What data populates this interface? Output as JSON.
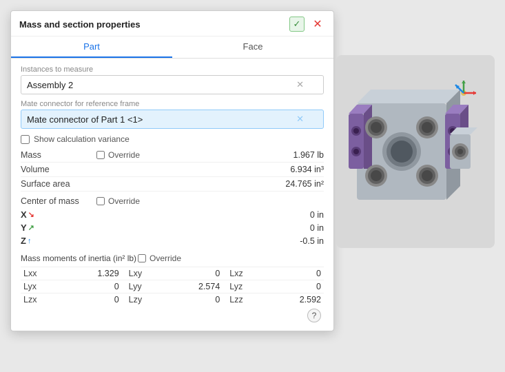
{
  "dialog": {
    "title": "Mass and section properties",
    "check_label": "✓",
    "close_label": "✕",
    "tabs": [
      {
        "label": "Part",
        "active": true
      },
      {
        "label": "Face",
        "active": false
      }
    ],
    "instances_label": "Instances to measure",
    "instances_value": "Assembly 2",
    "mate_label": "Mate connector for reference frame",
    "mate_value": "Mate connector of Part 1 <1>",
    "show_variance_label": "Show calculation variance",
    "mass_label": "Mass",
    "mass_override_label": "Override",
    "mass_value": "1.967 lb",
    "volume_label": "Volume",
    "volume_value": "6.934 in³",
    "surface_area_label": "Surface area",
    "surface_area_value": "24.765 in²",
    "com_label": "Center of mass",
    "com_override_label": "Override",
    "x_label": "X",
    "x_value": "0 in",
    "y_label": "Y",
    "y_value": "0 in",
    "z_label": "Z",
    "z_value": "-0.5 in",
    "inertia_label": "Mass moments of inertia (in² lb)",
    "inertia_override_label": "Override",
    "lxx_label": "Lxx",
    "lxx_value": "1.329",
    "lxy_label": "Lxy",
    "lxy_value": "0",
    "lxz_label": "Lxz",
    "lxz_value": "0",
    "lyx_label": "Lyx",
    "lyx_value": "0",
    "lyy_label": "Lyy",
    "lyy_value": "2.574",
    "lyz_label": "Lyz",
    "lyz_value": "0",
    "lzx_label": "Lzx",
    "lzx_value": "0",
    "lzy_label": "Lzy",
    "lzy_value": "0",
    "lzz_label": "Lzz",
    "lzz_value": "2.592",
    "help_label": "?"
  }
}
